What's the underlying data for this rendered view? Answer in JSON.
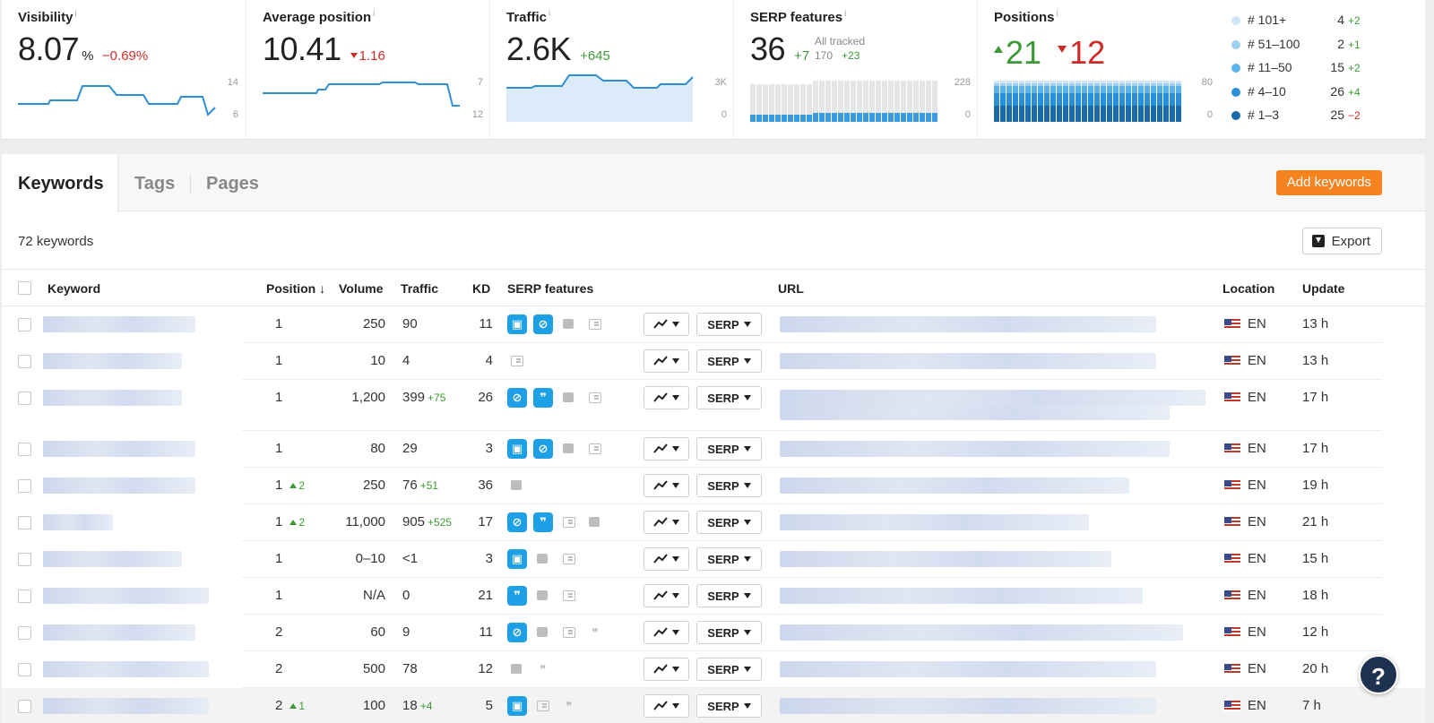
{
  "metrics": {
    "visibility": {
      "title": "Visibility",
      "value": "8.07",
      "unit": "%",
      "delta": "−0.69%",
      "axis_top": "14",
      "axis_bottom": "6"
    },
    "avg_position": {
      "title": "Average position",
      "value": "10.41",
      "delta": "1.16",
      "axis_top": "7",
      "axis_bottom": "12"
    },
    "traffic": {
      "title": "Traffic",
      "value": "2.6K",
      "delta": "+645",
      "axis_top": "3K",
      "axis_bottom": "0"
    },
    "serp_features": {
      "title": "SERP features",
      "value": "36",
      "delta": "+7",
      "tracked_label": "All tracked",
      "tracked_value": "170",
      "tracked_delta": "+23",
      "axis_top": "228",
      "axis_bottom": "0"
    },
    "positions": {
      "title": "Positions",
      "up": "21",
      "down": "12",
      "axis_top": "80",
      "axis_bottom": "0"
    },
    "info_icon": "i",
    "legend": [
      {
        "label": "# 101+",
        "count": "4",
        "change": "+2",
        "trend": "up",
        "color": "#cfe6f8"
      },
      {
        "label": "# 51–100",
        "count": "2",
        "change": "+1",
        "trend": "up",
        "color": "#9fd0f2"
      },
      {
        "label": "# 11–50",
        "count": "15",
        "change": "+2",
        "trend": "up",
        "color": "#5bb3ea"
      },
      {
        "label": "# 4–10",
        "count": "26",
        "change": "+4",
        "trend": "up",
        "color": "#2a8fd6"
      },
      {
        "label": "# 1–3",
        "count": "25",
        "change": "−2",
        "trend": "down",
        "color": "#1a6aa8"
      }
    ]
  },
  "tabs": [
    {
      "label": "Keywords",
      "active": true
    },
    {
      "label": "Tags",
      "active": false
    },
    {
      "label": "Pages",
      "active": false
    }
  ],
  "toolbar": {
    "add_keywords": "Add keywords",
    "keyword_count": "72 keywords",
    "export": "Export"
  },
  "table": {
    "headers": {
      "keyword": "Keyword",
      "position": "Position ↓",
      "volume": "Volume",
      "traffic": "Traffic",
      "kd": "KD",
      "serp_features": "SERP features",
      "url": "URL",
      "location": "Location",
      "update": "Update"
    },
    "serp_button": "SERP",
    "rows": [
      {
        "position": "1",
        "pos_change": "",
        "volume": "250",
        "traffic": "90",
        "traffic_change": "",
        "kd": "11",
        "features": [
          "img",
          "link",
          "bubble",
          "box"
        ],
        "lang": "EN",
        "update": "13 h"
      },
      {
        "position": "1",
        "pos_change": "",
        "volume": "10",
        "traffic": "4",
        "traffic_change": "",
        "kd": "4",
        "features": [
          "box"
        ],
        "lang": "EN",
        "update": "13 h"
      },
      {
        "position": "1",
        "pos_change": "",
        "volume": "1,200",
        "traffic": "399",
        "traffic_change": "+75",
        "kd": "26",
        "features": [
          "link",
          "quote",
          "bubble",
          "box"
        ],
        "lang": "EN",
        "update": "17 h"
      },
      {
        "position": "1",
        "pos_change": "",
        "volume": "80",
        "traffic": "29",
        "traffic_change": "",
        "kd": "3",
        "features": [
          "img",
          "link",
          "bubble",
          "box"
        ],
        "lang": "EN",
        "update": "17 h"
      },
      {
        "position": "1",
        "pos_change": "2",
        "volume": "250",
        "traffic": "76",
        "traffic_change": "+51",
        "kd": "36",
        "features": [
          "bubble"
        ],
        "lang": "EN",
        "update": "19 h"
      },
      {
        "position": "1",
        "pos_change": "2",
        "volume": "11,000",
        "traffic": "905",
        "traffic_change": "+525",
        "kd": "17",
        "features": [
          "link",
          "quote",
          "box",
          "bubble"
        ],
        "lang": "EN",
        "update": "21 h"
      },
      {
        "position": "1",
        "pos_change": "",
        "volume": "0–10",
        "traffic": "<1",
        "traffic_change": "",
        "kd": "3",
        "features": [
          "img",
          "bubble",
          "box"
        ],
        "lang": "EN",
        "update": "15 h"
      },
      {
        "position": "1",
        "pos_change": "",
        "volume": "N/A",
        "traffic": "0",
        "traffic_change": "",
        "kd": "21",
        "features": [
          "quote",
          "bubble",
          "box"
        ],
        "lang": "EN",
        "update": "18 h"
      },
      {
        "position": "2",
        "pos_change": "",
        "volume": "60",
        "traffic": "9",
        "traffic_change": "",
        "kd": "11",
        "features": [
          "link",
          "bubble",
          "box",
          "gquote"
        ],
        "lang": "EN",
        "update": "12 h"
      },
      {
        "position": "2",
        "pos_change": "",
        "volume": "500",
        "traffic": "78",
        "traffic_change": "",
        "kd": "12",
        "features": [
          "bubble",
          "gquote"
        ],
        "lang": "EN",
        "update": "20 h"
      },
      {
        "position": "2",
        "pos_change": "1",
        "volume": "100",
        "traffic": "18",
        "traffic_change": "+4",
        "kd": "5",
        "features": [
          "img",
          "box",
          "gquote"
        ],
        "lang": "EN",
        "update": "7 h"
      }
    ]
  },
  "help_label": "?",
  "colors": {
    "accent": "#f5831f",
    "feature_blue": "#1ea0e6",
    "positive": "#3c9a35",
    "negative": "#cf2a27"
  }
}
